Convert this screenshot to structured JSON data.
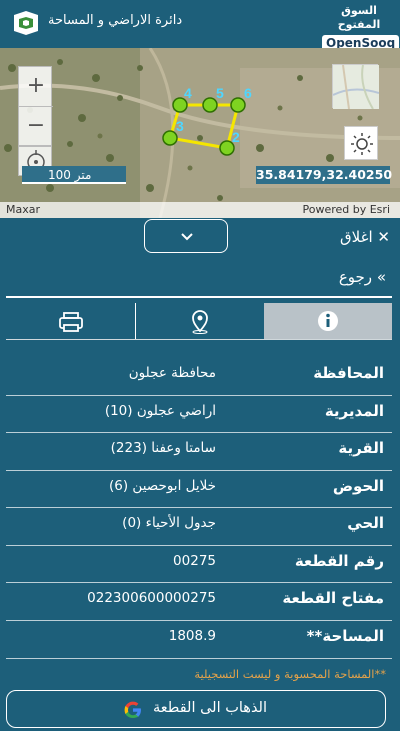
{
  "header": {
    "title": "دائرة الاراضي و المساحة",
    "brand_top": "السوق المفتوح",
    "brand_bottom": "OpenSooq"
  },
  "map": {
    "scale_label": "100 متر",
    "coordinates": "35.84179,32.40250",
    "attribution_left": "Maxar",
    "attribution_right": "Powered by Esri",
    "parcel_vertices": [
      "2",
      "3",
      "4",
      "5",
      "6"
    ],
    "colors": {
      "vertex": "#7ed321",
      "edge": "#f5e600",
      "vertex_label": "#4fd6ff"
    }
  },
  "panel": {
    "close_label": "اغلاق",
    "back_label": "رجوع",
    "tabs": [
      {
        "icon": "printer-icon"
      },
      {
        "icon": "map-pin-icon"
      },
      {
        "icon": "info-icon",
        "active": true
      }
    ],
    "details": [
      {
        "label": "المحافظة",
        "value": "محافظة عجلون"
      },
      {
        "label": "المديرية",
        "value": "اراضي عجلون (10)"
      },
      {
        "label": "القرية",
        "value": "سامتا وعفنا (223)"
      },
      {
        "label": "الحوض",
        "value": "خلايل ابوحصين (6)"
      },
      {
        "label": "الحي",
        "value": "جدول الأحياء (0)"
      },
      {
        "label": "رقم القطعة",
        "value": "00275"
      },
      {
        "label": "مفتاح القطعة",
        "value": "022300600000275"
      },
      {
        "label": "**المساحة",
        "value": "1808.9"
      }
    ],
    "note": "**المساحة المحسوبة و ليست التسجيلية",
    "goto_label": "الذهاب الى القطعة"
  }
}
